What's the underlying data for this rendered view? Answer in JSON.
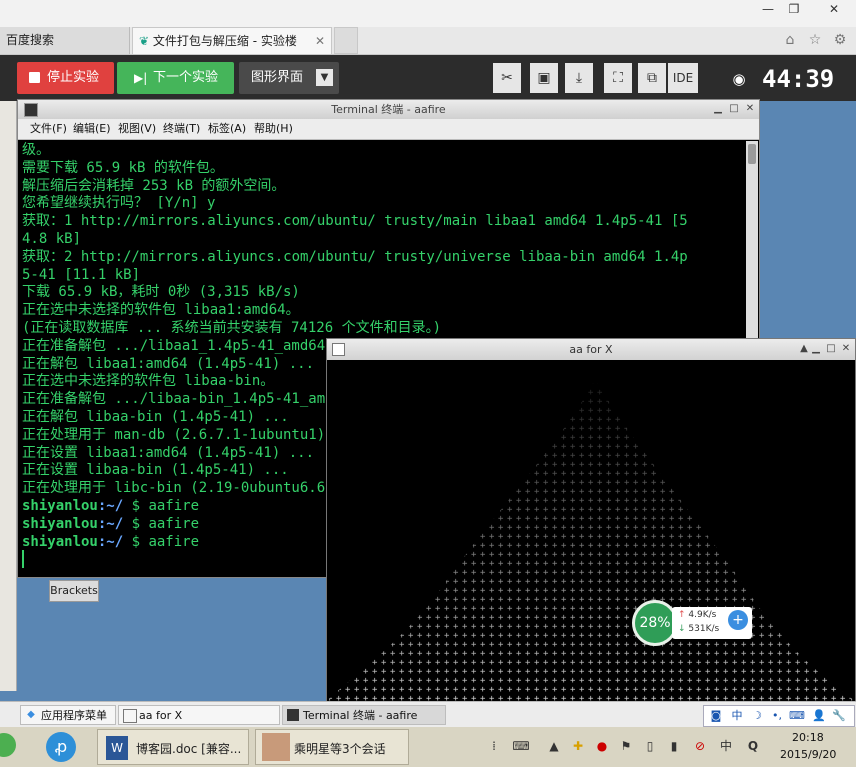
{
  "window_controls": {
    "minimize": "—",
    "restore": "❐",
    "close": "✕"
  },
  "browser": {
    "tabs": [
      {
        "label": "百度搜索"
      },
      {
        "label": "文件打包与解压缩 - 实验楼",
        "close": "✕"
      }
    ],
    "icons": [
      "home-icon",
      "star-icon",
      "settings-icon"
    ]
  },
  "lab_toolbar": {
    "stop_label": "停止实验",
    "next_label": "下一个实验",
    "gui_label": "图形界面",
    "tools": [
      "scissors-icon",
      "screen-icon",
      "download-icon",
      "fullscreen-icon",
      "popout-icon"
    ],
    "ide_label": "IDE",
    "timer": "44:39",
    "accent_stop": "#e0413f",
    "accent_next": "#45b55a"
  },
  "terminal": {
    "title": "Terminal 终端 - aafire",
    "menu": [
      "文件(F)",
      "编辑(E)",
      "视图(V)",
      "终端(T)",
      "标签(A)",
      "帮助(H)"
    ],
    "lines": [
      "级。",
      "需要下载 65.9 kB 的软件包。",
      "解压缩后会消耗掉 253 kB 的额外空间。",
      "您希望继续执行吗？ [Y/n] y",
      "获取：1 http://mirrors.aliyuncs.com/ubuntu/ trusty/main libaa1 amd64 1.4p5-41 [5",
      "4.8 kB]",
      "获取：2 http://mirrors.aliyuncs.com/ubuntu/ trusty/universe libaa-bin amd64 1.4p",
      "5-41 [11.1 kB]",
      "下载 65.9 kB，耗时 0秒 (3,315 kB/s)",
      "正在选中未选择的软件包 libaa1:amd64。",
      "(正在读取数据库 ... 系统当前共安装有 74126 个文件和目录。)",
      "正在准备解包 .../libaa1_1.4p5-41_amd64.deb ...",
      "正在解包 libaa1:amd64 (1.4p5-41) ...",
      "正在选中未选择的软件包 libaa-bin。",
      "正在准备解包 .../libaa-bin_1.4p5-41_amd64.deb ...",
      "正在解包 libaa-bin (1.4p5-41) ...",
      "正在处理用于 man-db (2.6.7.1-1ubuntu1) 的触发器 ...",
      "正在设置 libaa1:amd64 (1.4p5-41) ...",
      "正在设置 libaa-bin (1.4p5-41) ...",
      "正在处理用于 libc-bin (2.19-0ubuntu6.6) 的触发器 ..."
    ],
    "prompts": [
      {
        "user": "shiyanlou",
        "path": ":~/",
        "cmd": " $ aafire"
      },
      {
        "user": "shiyanlou",
        "path": ":~/",
        "cmd": " $ aafire"
      },
      {
        "user": "shiyanlou",
        "path": ":~/",
        "cmd": " $ aafire"
      }
    ],
    "text_color": "#35d16a"
  },
  "desktop": {
    "brackets_label": "Brackets"
  },
  "aa_window": {
    "title": "aa for X"
  },
  "speed_widget": {
    "percent": "28%",
    "up": "4.9K/s",
    "down": "531K/s",
    "plus": "+"
  },
  "panel": {
    "apps_menu": "应用程序菜单",
    "tasks": [
      "aa for X",
      "Terminal 终端 - aafire"
    ],
    "ime": [
      "中",
      "☽",
      "•,",
      "⌨",
      "👤",
      "🔧"
    ]
  },
  "taskbar": {
    "doc_label": "博客园.doc [兼容...",
    "qq_label": "乘明星等3个会话",
    "time": "20:18",
    "date": "2015/9/20",
    "tray_ime": "中",
    "tray_q": "Q"
  }
}
